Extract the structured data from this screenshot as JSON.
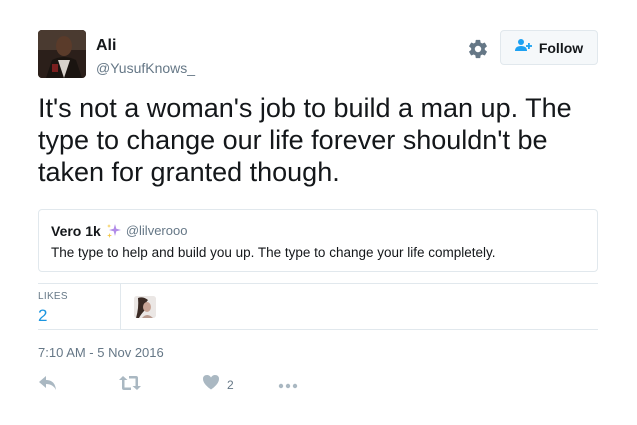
{
  "author": {
    "name": "Ali",
    "handle": "@YusufKnows_",
    "avatar": "avatar"
  },
  "header": {
    "settings_icon": "gear-icon",
    "follow_label": "Follow",
    "follow_icon": "add-user-icon"
  },
  "tweet": {
    "text": "It's not a woman's job to build a man up. The type to change our life forever shouldn't be taken for granted though."
  },
  "quote": {
    "name": "Vero 1k",
    "emoji_icon": "sparkles-icon",
    "handle": "@lilverooo",
    "text": "The type to help and build you up. The type to change your life completely."
  },
  "stats": {
    "likes_label": "LIKES",
    "likes_count": "2"
  },
  "timestamp": "7:10 AM - 5 Nov 2016",
  "actions": {
    "reply_icon": "reply-icon",
    "retweet_icon": "retweet-icon",
    "like_icon": "heart-icon",
    "like_count": "2",
    "more_icon": "more-icon"
  },
  "colors": {
    "text": "#14171a",
    "secondary": "#657786",
    "link": "#1b95e0",
    "border": "#e1e8ed",
    "icon": "#aab8c2"
  }
}
